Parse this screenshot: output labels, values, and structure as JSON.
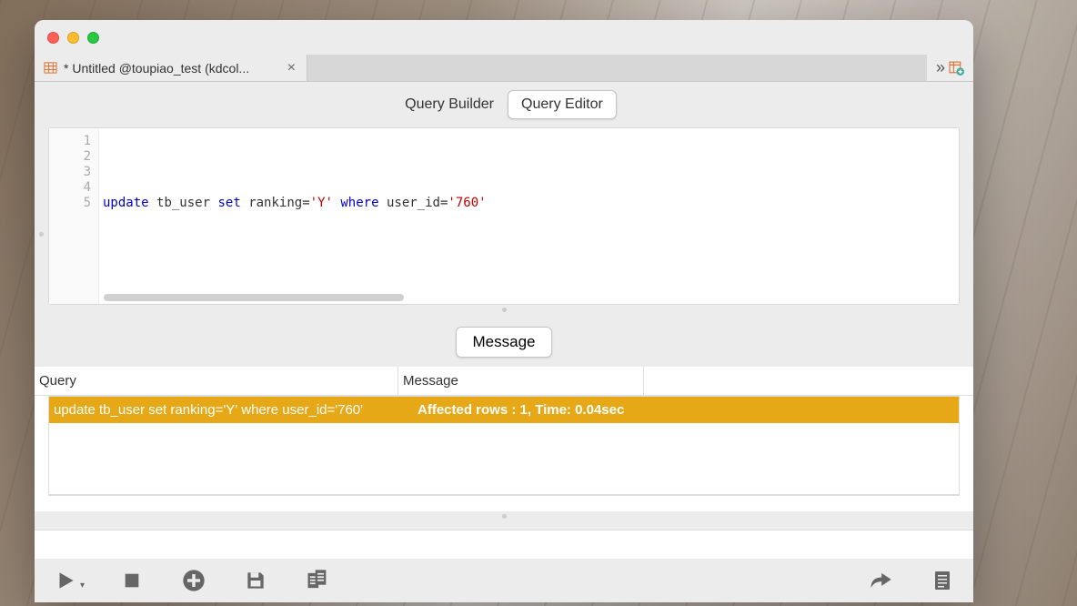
{
  "tab": {
    "title": "* Untitled @toupiao_test (kdcol..."
  },
  "modes": {
    "builder": "Query Builder",
    "editor": "Query Editor"
  },
  "editor": {
    "line_numbers": [
      "1",
      "2",
      "3",
      "4",
      "5"
    ],
    "sql": {
      "kw_update": "update",
      "ident_table": "tb_user",
      "kw_set": "set",
      "ident_col": "ranking=",
      "str1": "'Y'",
      "kw_where": "where",
      "ident_where": "user_id=",
      "str2": "'760'"
    }
  },
  "message_tab": "Message",
  "result": {
    "headers": {
      "query": "Query",
      "message": "Message"
    },
    "row": {
      "query": "update tb_user set ranking='Y' where user_id='760'",
      "message": "Affected rows : 1, Time: 0.04sec"
    }
  }
}
